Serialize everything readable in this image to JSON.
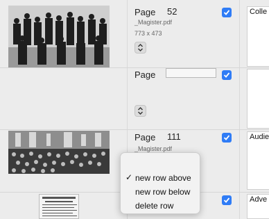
{
  "rows": [
    {
      "page_label": "Page",
      "page_number": "52",
      "filename": "_Magister.pdf",
      "dimensions": "773 x 473",
      "text": "Colle",
      "photo": "group-portrait",
      "checked": true
    },
    {
      "page_label": "Page",
      "page_number": "",
      "filename": "",
      "dimensions": "",
      "text": "",
      "photo": "",
      "checked": true
    },
    {
      "page_label": "Page",
      "page_number": "111",
      "filename": "_Magister.pdf",
      "dimensions": "",
      "text": "Audie",
      "photo": "audience-photo",
      "checked": true
    },
    {
      "page_label": "",
      "page_number": "",
      "filename": "",
      "dimensions": "",
      "text": "Adve",
      "photo": "newspaper-clipping",
      "checked": true
    }
  ],
  "context_menu": {
    "items": [
      {
        "label": "new row above",
        "checked": true
      },
      {
        "label": "new row below",
        "checked": false
      },
      {
        "label": "delete row",
        "checked": false
      }
    ],
    "check_glyph": "✓"
  },
  "icons": {
    "stepper": "stepper-icon",
    "checkbox": "checkmark-icon"
  },
  "colors": {
    "accent": "#2f7cf6",
    "background": "#ececec"
  }
}
